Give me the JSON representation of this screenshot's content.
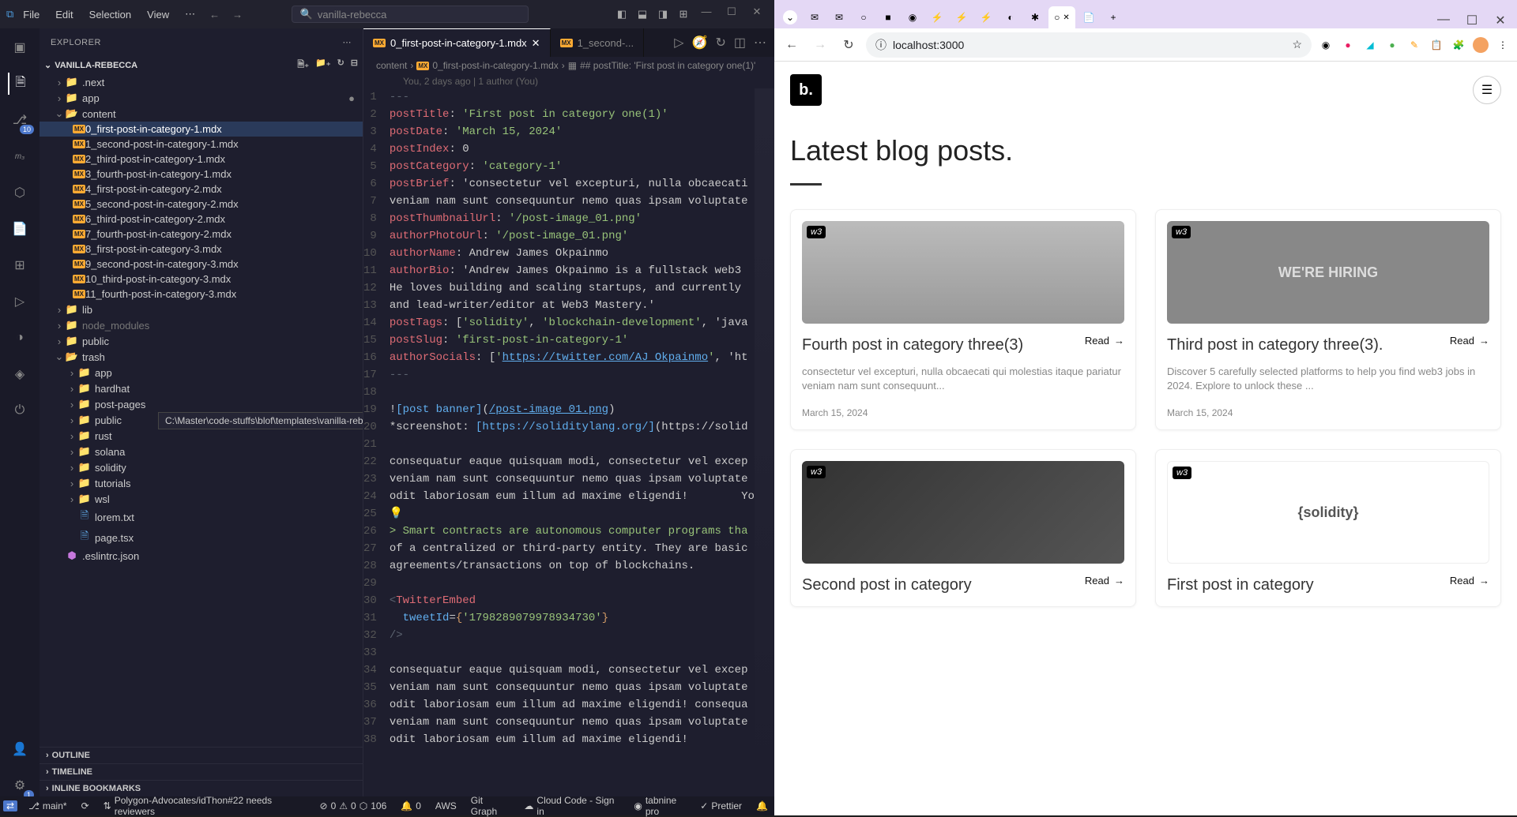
{
  "vscode": {
    "menu": [
      "File",
      "Edit",
      "Selection",
      "View"
    ],
    "search_placeholder": "vanilla-rebecca",
    "explorer_label": "EXPLORER",
    "project_name": "VANILLA-REBECCA",
    "source_control_badge": "10",
    "tree": {
      "next": ".next",
      "app": "app",
      "content": "content",
      "content_files": [
        "0_first-post-in-category-1.mdx",
        "1_second-post-in-category-1.mdx",
        "2_third-post-in-category-1.mdx",
        "3_fourth-post-in-category-1.mdx",
        "4_first-post-in-category-2.mdx",
        "5_second-post-in-category-2.mdx",
        "6_third-post-in-category-2.mdx",
        "7_fourth-post-in-category-2.mdx",
        "8_first-post-in-category-3.mdx",
        "9_second-post-in-category-3.mdx",
        "10_third-post-in-category-3.mdx",
        "11_fourth-post-in-category-3.mdx"
      ],
      "lib": "lib",
      "node_modules": "node_modules",
      "public": "public",
      "trash": "trash",
      "trash_items": [
        "app",
        "hardhat",
        "post-pages",
        "public",
        "rust",
        "solana",
        "solidity",
        "tutorials",
        "wsl",
        "lorem.txt",
        "page.tsx"
      ],
      "eslint": ".eslintrc.json",
      "tooltip": "C:\\Master\\code-stuffs\\blof\\templates\\vanilla-rebecca\\trash\\post-pages"
    },
    "outline": "OUTLINE",
    "timeline": "TIMELINE",
    "bookmarks": "INLINE BOOKMARKS",
    "tabs": {
      "active": "0_first-post-in-category-1.mdx",
      "second": "1_second-..."
    },
    "breadcrumb": {
      "a": "content",
      "b": "0_first-post-in-category-1.mdx",
      "c": "## postTitle: 'First post in category one(1)'"
    },
    "blame": "You, 2 days ago | 1 author (You)",
    "code_lines": [
      "---",
      "postTitle: 'First post in category one(1)'",
      "postDate: 'March 15, 2024'",
      "postIndex: 0",
      "postCategory: 'category-1'",
      "postBrief: 'consectetur vel excepturi, nulla obcaecati",
      "veniam nam sunt consequuntur nemo quas ipsam voluptate",
      "postThumbnailUrl: '/post-image_01.png'",
      "authorPhotoUrl: '/post-image_01.png'",
      "authorName: Andrew James Okpainmo",
      "authorBio: 'Andrew James Okpainmo is a fullstack web3",
      "He loves building and scaling startups, and currently",
      "and lead-writer/editor at Web3 Mastery.'",
      "postTags: ['solidity', 'blockchain-development', 'java",
      "postSlug: 'first-post-in-category-1'",
      "authorSocials: ['https://twitter.com/AJ_Okpainmo', 'ht",
      "---",
      "",
      "![post banner](/post-image_01.png)",
      "*screenshot: [https://soliditylang.org/](https://solid",
      "",
      "consequatur eaque quisquam modi, consectetur vel excep",
      "veniam nam sunt consequuntur nemo quas ipsam voluptate",
      "odit laboriosam eum illum ad maxime eligendi!        Yo",
      "",
      "> Smart contracts are autonomous computer programs tha",
      "of a centralized or third-party entity. They are basic",
      "agreements/transactions on top of blockchains.",
      "",
      "<TwitterEmbed",
      "  tweetId={'1798289079978934730'}",
      "/>",
      "",
      "consequatur eaque quisquam modi, consectetur vel excep",
      "veniam nam sunt consequuntur nemo quas ipsam voluptate",
      "odit laboriosam eum illum ad maxime eligendi! consequa",
      "veniam nam sunt consequuntur nemo quas ipsam voluptate",
      "odit laboriosam eum illum ad maxime eligendi!"
    ],
    "status": {
      "remote": "",
      "branch": "main*",
      "sync": "",
      "pr": "Polygon-Advocates/idThon#22 needs reviewers",
      "errors": "0",
      "warnings": "0",
      "ports": "106",
      "notif": "0",
      "aws": "AWS",
      "git": "Git Graph",
      "cloud": "Cloud Code - Sign in",
      "tabnine": "tabnine pro",
      "prettier": "Prettier"
    }
  },
  "chrome": {
    "url": "localhost:3000",
    "blog_heading": "Latest blog posts.",
    "posts": [
      {
        "title": "Fourth post in category three(3)",
        "brief": "consectetur vel excepturi, nulla obcaecati qui molestias itaque pariatur veniam nam sunt consequunt...",
        "date": "March 15, 2024",
        "img": "office"
      },
      {
        "title": "Third post in category three(3).",
        "brief": "Discover 5 carefully selected platforms to help you find web3 jobs in 2024. Explore to unlock these ...",
        "date": "March 15, 2024",
        "img": "hiring"
      },
      {
        "title": "Second post in category",
        "brief": "",
        "date": "",
        "img": "keyboard"
      },
      {
        "title": "First post in category",
        "brief": "",
        "date": "",
        "img": "solidity"
      }
    ],
    "read_label": "Read"
  }
}
